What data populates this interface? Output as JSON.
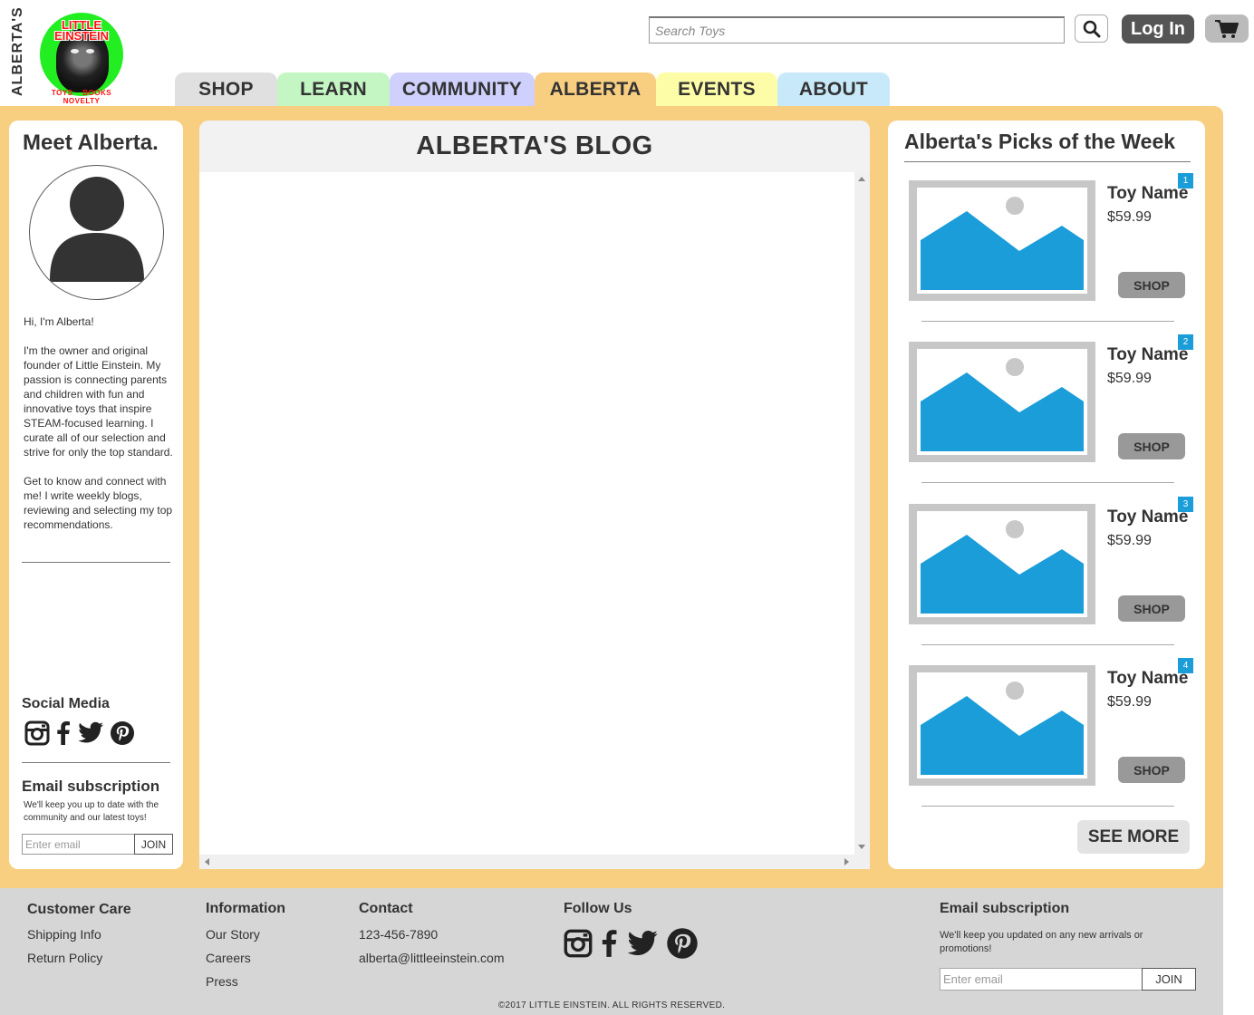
{
  "header": {
    "vertical_brand": "ALBERTA'S",
    "logo": {
      "title_line1": "LITTLE",
      "title_line2": "EINSTEIN",
      "tagline": "TOYS BOOKS NOVELTY"
    },
    "search": {
      "placeholder": "Search Toys",
      "value": ""
    },
    "login_label": "Log In",
    "icons": {
      "search": "search-icon",
      "cart": "cart-icon"
    }
  },
  "nav": {
    "tabs": [
      {
        "label": "SHOP",
        "color": "#e0e0e0"
      },
      {
        "label": "LEARN",
        "color": "#c3f6c3"
      },
      {
        "label": "COMMUNITY",
        "color": "#cfd0fd"
      },
      {
        "label": "ALBERTA",
        "color": "#f8ce81",
        "active": true
      },
      {
        "label": "EVENTS",
        "color": "#fefda7"
      },
      {
        "label": "ABOUT",
        "color": "#c8e9f9"
      }
    ]
  },
  "left": {
    "title": "Meet Alberta.",
    "bio": [
      "Hi, I'm Alberta!",
      "I'm the owner and original founder of Little Einstein. My passion is connecting parents and children with fun and innovative toys that inspire STEAM-focused learning. I curate all of our selection and strive for only the top standard.",
      "Get to know and connect with me! I write weekly blogs, reviewing and selecting my top recommendations."
    ],
    "social_title": "Social Media",
    "social_icons": [
      "instagram-icon",
      "facebook-icon",
      "twitter-icon",
      "pinterest-icon"
    ],
    "subscription": {
      "title": "Email subscription",
      "description": "We'll keep you up to date with the community and our latest toys!",
      "placeholder": "Enter email",
      "button": "JOIN"
    }
  },
  "blog": {
    "title": "ALBERTA'S BLOG"
  },
  "picks": {
    "title": "Alberta's Picks of the Week",
    "items": [
      {
        "rank": "1",
        "name": "Toy Name",
        "price": "$59.99",
        "button": "SHOP"
      },
      {
        "rank": "2",
        "name": "Toy Name",
        "price": "$59.99",
        "button": "SHOP"
      },
      {
        "rank": "3",
        "name": "Toy Name",
        "price": "$59.99",
        "button": "SHOP"
      },
      {
        "rank": "4",
        "name": "Toy Name",
        "price": "$59.99",
        "button": "SHOP"
      }
    ],
    "see_more": "SEE MORE"
  },
  "footer": {
    "customer_care": {
      "title": "Customer Care",
      "links": [
        "Shipping Info",
        "Return Policy"
      ]
    },
    "information": {
      "title": "Information",
      "links": [
        "Our Story",
        "Careers",
        "Press"
      ]
    },
    "contact": {
      "title": "Contact",
      "phone": "123-456-7890",
      "email": "alberta@littleeinstein.com"
    },
    "follow": {
      "title": "Follow Us",
      "icons": [
        "instagram-icon",
        "facebook-icon",
        "twitter-icon",
        "pinterest-icon"
      ]
    },
    "subscription": {
      "title": "Email subscription",
      "description": "We'll keep you updated on any new arrivals or promotions!",
      "placeholder": "Enter email",
      "button": "JOIN"
    },
    "copyright": "©2017 LITTLE EINSTEIN. ALL RIGHTS RESERVED."
  },
  "colors": {
    "accent_orange": "#f8ce81",
    "badge_blue": "#1a9dd9",
    "placeholder_blue": "#1a9dd9",
    "footer_gray": "#d6d6d6",
    "login_dark": "#555555"
  }
}
